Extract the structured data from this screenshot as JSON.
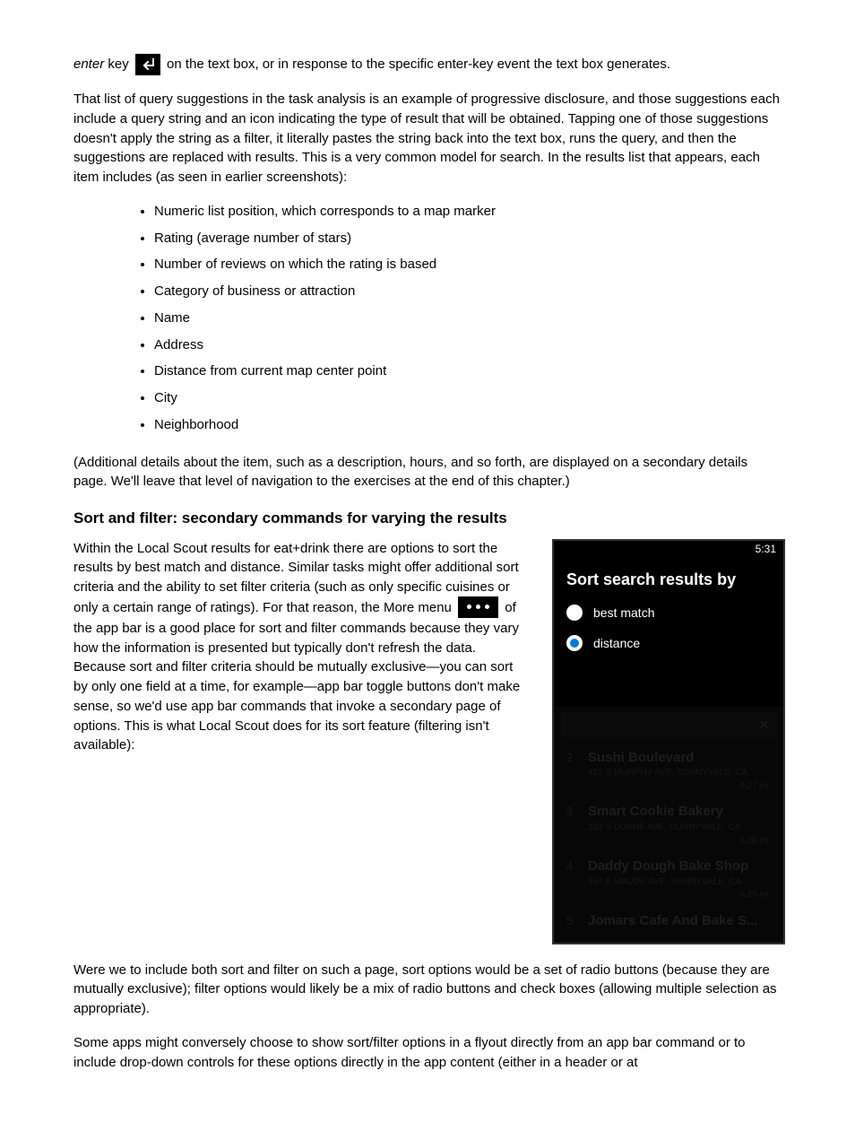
{
  "para1_a": "enter",
  "para1_b": " key ",
  "para1_c": " on the text box, or in response to the specific enter-key event the text box generates.",
  "para2": "That list of query suggestions in the task analysis is an example of progressive disclosure, and those suggestions each include a query string and an icon indicating the type of result that will be obtained. Tapping one of those suggestions doesn't apply the string as a filter, it literally pastes the string back into the text box, runs the query, and then the suggestions are replaced with results. This is a very common model for search. In the results list that appears, each item includes (as seen in earlier screenshots):",
  "list": [
    "Numeric list position, which corresponds to a map marker",
    "Rating (average number of stars)",
    "Number of reviews on which the rating is based",
    "Category of business or attraction",
    "Name",
    "Address",
    "Distance from current map center point",
    "City",
    "Neighborhood"
  ],
  "para3": "(Additional details about the item, such as a description, hours, and so forth, are displayed on a secondary details page. We'll leave that level of navigation to the exercises at the end of this chapter.)",
  "sort_heading": "Sort and filter: secondary commands for varying the results",
  "para4_a": "Within the Local Scout results for eat+drink there are options to sort the results by best match and distance. Similar tasks might offer additional sort criteria and the ability to set filter criteria (such as only specific cuisines or only a certain range of ratings). For that reason, the More menu ",
  "para4_b": " of the app bar is a good place for sort and filter commands because they vary how the information is presented but typically don't refresh the data. Because sort and filter criteria should be mutually exclusive—you can sort by only one field at a time, for example—app bar toggle buttons don't make sense, so we'd use app bar commands that invoke a secondary page of options. This is what Local Scout does for its sort feature (filtering isn't available):",
  "phone": {
    "time": "5:31",
    "sort_title": "Sort search results by",
    "options": [
      {
        "label": "best match",
        "selected": false
      },
      {
        "label": "distance",
        "selected": true
      }
    ],
    "results": [
      {
        "num": "2",
        "name": "Sushi Boulevard",
        "addr": "482 S MURPHY AVE, SUNNYVALE, CA",
        "dist": "0.27 mi"
      },
      {
        "num": "3",
        "name": "Smart Cookie Bakery",
        "addr": "183 S DUANE AVE, SUNNYVALE, CA",
        "dist": "0.28 mi"
      },
      {
        "num": "4",
        "name": "Daddy Dough Bake Shop",
        "addr": "357 E MAUDE AVE, SUNNYVALE, CA",
        "dist": "0.29 mi"
      },
      {
        "num": "5",
        "name": "Jomars Cafe And Bake S...",
        "addr": "",
        "dist": ""
      }
    ]
  },
  "para5": "Were we to include both sort and filter on such a page, sort options would be a set of radio buttons (because they are mutually exclusive); filter options would likely be a mix of radio buttons and check boxes (allowing multiple selection as appropriate).",
  "para6": "Some apps might conversely choose to show sort/filter options in a flyout directly from an app bar command or to include drop-down controls for these options directly in the app content (either in a header or at"
}
